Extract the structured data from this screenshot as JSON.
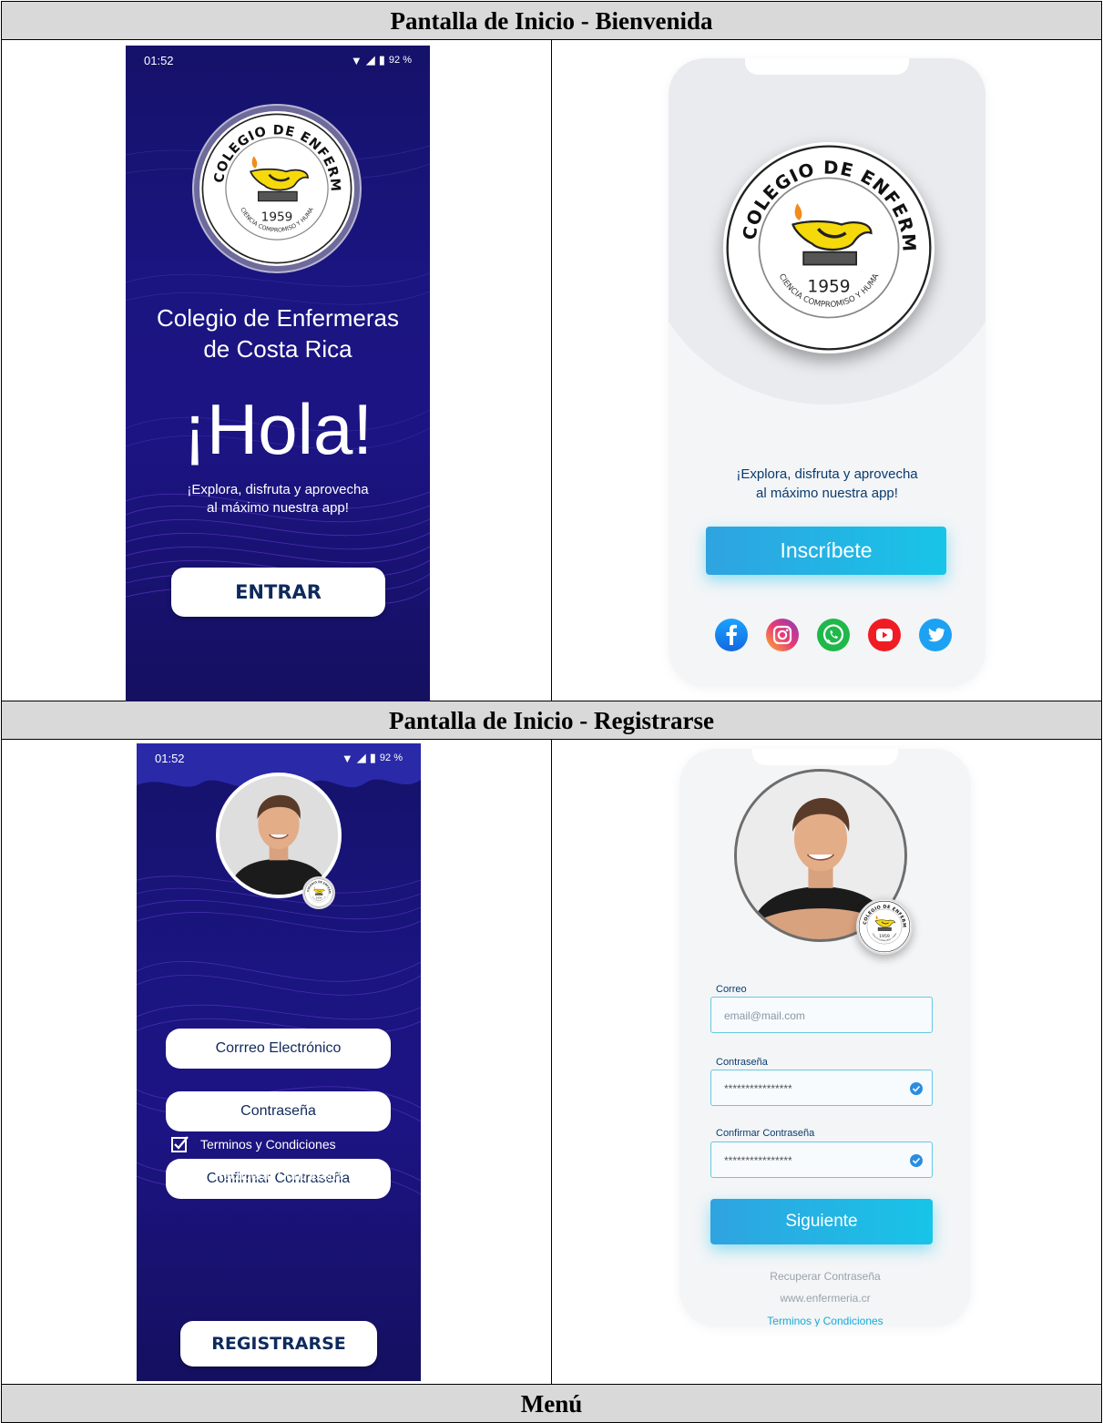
{
  "section1": {
    "title": "Pantalla de Inicio - Bienvenida"
  },
  "section2": {
    "title": "Pantalla de Inicio - Registrarse"
  },
  "section3": {
    "title": "Menú"
  },
  "status_bar": {
    "time": "01:52",
    "battery": "92 %"
  },
  "seal": {
    "top_text": "COLEGIO DE ENFERMERAS DE COSTA RICA",
    "year": "1959",
    "motto": "CIENCIA COMPROMISO Y HUMANISMO"
  },
  "welcome_dark": {
    "brand_line1": "Colegio de Enfermeras",
    "brand_line2": "de Costa Rica",
    "greeting": "¡Hola!",
    "tagline_line1": "¡Explora, disfruta y aprovecha",
    "tagline_line2": "al máximo nuestra app!",
    "enter_button": "ENTRAR"
  },
  "welcome_light": {
    "tagline_line1": "¡Explora, disfruta y aprovecha",
    "tagline_line2": "al máximo nuestra app!",
    "signup_button": "Inscríbete",
    "social_icons": [
      "facebook-icon",
      "instagram-icon",
      "whatsapp-icon",
      "youtube-icon",
      "twitter-icon"
    ]
  },
  "register_dark": {
    "email_field": "Corrreo Electrónico",
    "password_field": "Contraseña",
    "confirm_field": "Confirmar Contraseña",
    "terms": "Terminos y Condiciones",
    "recover": "Recuperar Contraseña",
    "register_button": "REGISTRARSE"
  },
  "register_light": {
    "email_label": "Correo",
    "email_placeholder": "email@mail.com",
    "password_label": "Contraseña",
    "password_value": "****************",
    "confirm_label": "Confirmar Contraseña",
    "confirm_value": "****************",
    "next_button": "Siguiente",
    "recover": "Recuperar Contraseña",
    "website": "www.enfermeria.cr",
    "terms": "Terminos y Condiciones"
  },
  "colors": {
    "dark_bg": "#1a1580",
    "accent_cyan": "#18c4e8",
    "text_navy": "#0b3b6e"
  }
}
